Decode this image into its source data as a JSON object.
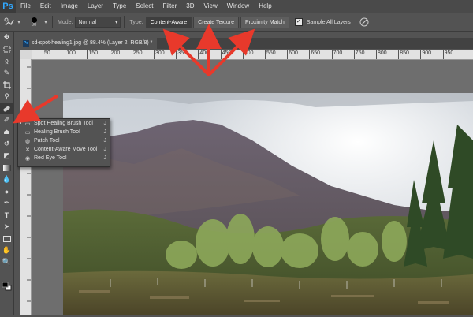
{
  "app": {
    "logo": "Ps"
  },
  "menu": {
    "items": [
      "File",
      "Edit",
      "Image",
      "Layer",
      "Type",
      "Select",
      "Filter",
      "3D",
      "View",
      "Window",
      "Help"
    ]
  },
  "options": {
    "brush_size": "30",
    "mode_label": "Mode:",
    "mode_value": "Normal",
    "type_label": "Type:",
    "type_buttons": [
      "Content-Aware",
      "Create Texture",
      "Proximity Match"
    ],
    "active_type": "Content-Aware",
    "sample_all_label": "Sample All Layers",
    "sample_all_checked": true
  },
  "document": {
    "tab_title": "sd-spot-healing1.jpg @ 88.4% (Layer 2, RGB/8) *",
    "tab_icon": "Ps"
  },
  "ruler": {
    "ticks": [
      "50",
      "100",
      "150",
      "200",
      "250",
      "300",
      "350",
      "400",
      "450",
      "500",
      "550",
      "600",
      "650",
      "700",
      "750",
      "800",
      "850",
      "900",
      "950"
    ]
  },
  "flyout": {
    "items": [
      {
        "label": "Spot Healing Brush Tool",
        "key": "J",
        "icon": "spot-healing-brush-icon",
        "selected": true
      },
      {
        "label": "Healing Brush Tool",
        "key": "J",
        "icon": "healing-brush-icon",
        "selected": false
      },
      {
        "label": "Patch Tool",
        "key": "J",
        "icon": "patch-icon",
        "selected": false
      },
      {
        "label": "Content-Aware Move Tool",
        "key": "J",
        "icon": "content-aware-move-icon",
        "selected": false
      },
      {
        "label": "Red Eye Tool",
        "key": "J",
        "icon": "red-eye-icon",
        "selected": false
      }
    ]
  },
  "colors": {
    "accent": "#31a8ff",
    "annotation_arrow": "#e8392b"
  }
}
